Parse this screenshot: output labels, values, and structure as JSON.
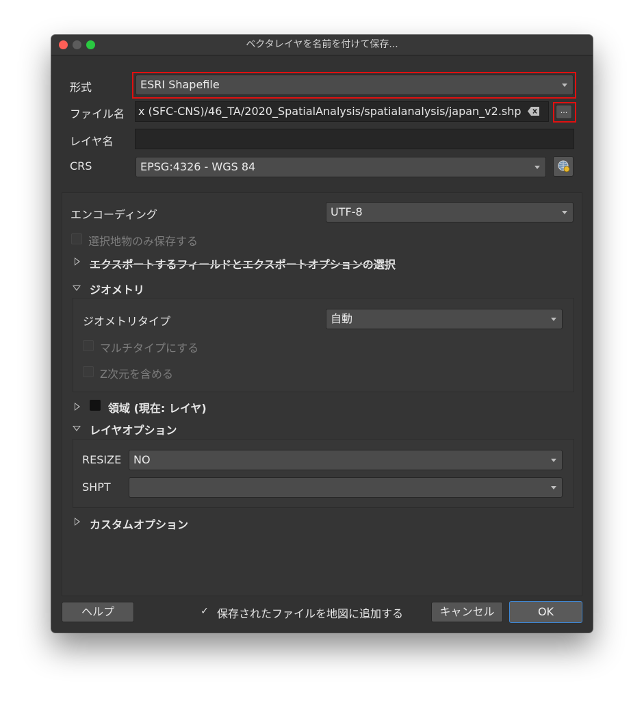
{
  "window": {
    "title": "ベクタレイヤを名前を付けて保存..."
  },
  "form": {
    "format_label": "形式",
    "format_value": "ESRI Shapefile",
    "filename_label": "ファイル名",
    "filename_value": "x (SFC-CNS)/46_TA/2020_SpatialAnalysis/spatialanalysis/japan_v2.shp",
    "browse_label": "...",
    "layername_label": "レイヤ名",
    "layername_value": "",
    "crs_label": "CRS",
    "crs_value": "EPSG:4326 - WGS 84"
  },
  "encoding": {
    "label": "エンコーディング",
    "value": "UTF-8"
  },
  "selected_only": {
    "label": "選択地物のみ保存する"
  },
  "fields_section": {
    "label": "エクスポートするフィールドとエクスポートオプションの選択"
  },
  "geometry": {
    "section_label": "ジオメトリ",
    "type_label": "ジオメトリタイプ",
    "type_value": "自動",
    "multitype_label": "マルチタイプにする",
    "z_label": "Z次元を含める"
  },
  "extent": {
    "label": "領域 (現在: レイヤ)"
  },
  "layer_options": {
    "section_label": "レイヤオプション",
    "resize_label": "RESIZE",
    "resize_value": "NO",
    "shpt_label": "SHPT",
    "shpt_value": ""
  },
  "custom_options": {
    "label": "カスタムオプション"
  },
  "footer": {
    "help_label": "ヘルプ",
    "add_to_map_check": "✓",
    "add_to_map_label": "保存されたファイルを地図に追加する",
    "cancel_label": "キャンセル",
    "ok_label": "OK"
  },
  "colors": {
    "highlight": "#e01010",
    "window_bg": "#323232",
    "focus": "#3d87d6"
  }
}
